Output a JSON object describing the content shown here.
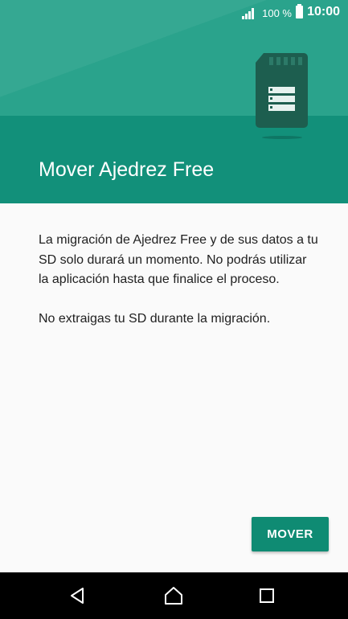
{
  "status_bar": {
    "battery_percent": "100 %",
    "time": "10:00",
    "icons": [
      "signal-icon",
      "battery-icon"
    ]
  },
  "header": {
    "title": "Mover Ajedrez Free",
    "illustration": "sd-card-icon",
    "colors": {
      "primary": "#0f8b73",
      "light": "#2aa38c"
    }
  },
  "content": {
    "paragraph_1": "La migración de Ajedrez Free y de sus datos a tu SD solo durará un momento. No podrás utilizar la aplicación hasta que finalice el proceso.",
    "paragraph_2": "No extraigas tu SD durante la migración."
  },
  "actions": {
    "move_label": "MOVER"
  },
  "navigation_bar": {
    "icons": [
      "back-icon",
      "home-icon",
      "recents-icon"
    ]
  }
}
